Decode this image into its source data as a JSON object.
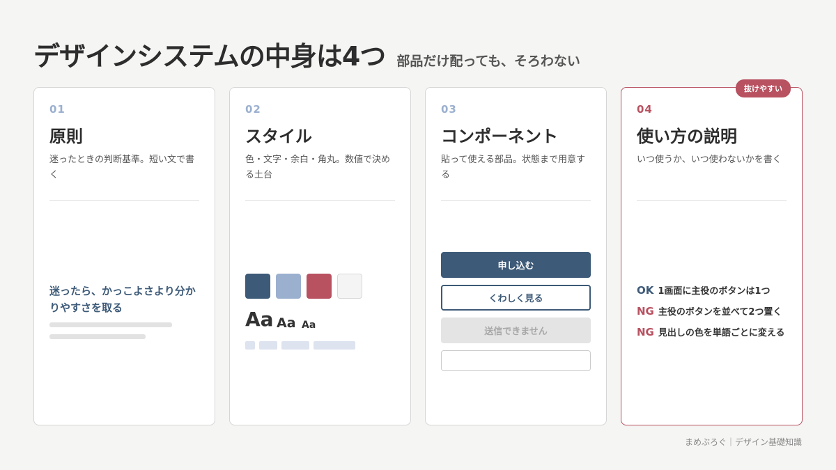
{
  "header": {
    "title": "デザインシステムの中身は4つ",
    "subtitle": "部品だけ配っても、そろわない"
  },
  "cards": [
    {
      "number": "01",
      "title": "原則",
      "description": "迷ったときの判断基準。短い文で書く",
      "example_quote": "迷ったら、かっこよさより分かりやすさを取る"
    },
    {
      "number": "02",
      "title": "スタイル",
      "description": "色・文字・余白・角丸。数値で決める土台",
      "swatches": [
        "#3d5a78",
        "#9bb0cf",
        "#b85160",
        "#f4f4f4"
      ],
      "type_samples": [
        "Aa",
        "Aa",
        "Aa"
      ]
    },
    {
      "number": "03",
      "title": "コンポーネント",
      "description": "貼って使える部品。状態まで用意する",
      "buttons": {
        "primary": "申し込む",
        "secondary": "くわしく見る",
        "disabled": "送信できません"
      }
    },
    {
      "number": "04",
      "title": "使い方の説明",
      "description": "いつ使うか、いつ使わないかを書く",
      "badge": "抜けやすい",
      "rules": [
        {
          "tag": "OK",
          "text": "1画面に主役のボタンは1つ"
        },
        {
          "tag": "NG",
          "text": "主役のボタンを並べて2つ置く"
        },
        {
          "tag": "NG",
          "text": "見出しの色を単語ごとに変える"
        }
      ]
    }
  ],
  "footer": "まめぶろぐ｜デザイン基礎知識",
  "colors": {
    "navy": "#3d5a78",
    "light_blue": "#9bb0cf",
    "accent_red": "#b85160",
    "background": "#f5f5f3"
  }
}
